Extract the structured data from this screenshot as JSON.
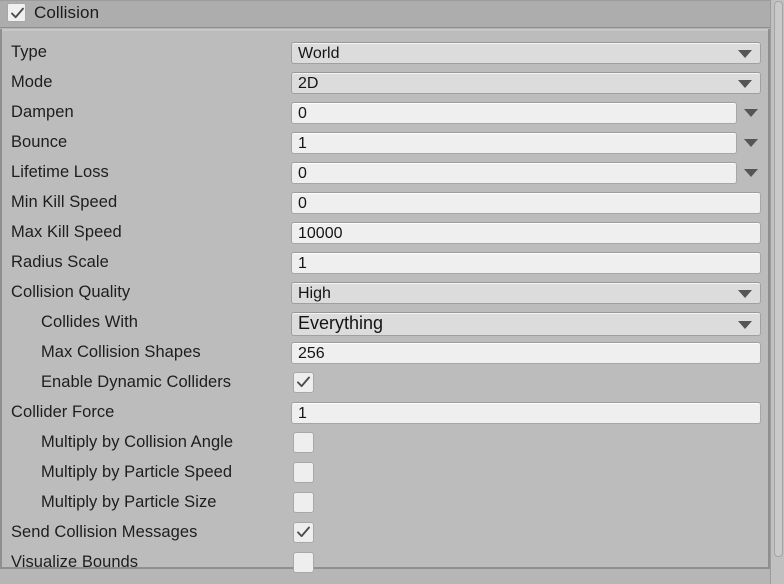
{
  "module": {
    "title": "Collision",
    "enabled": true,
    "checkbox_icon": "check-icon"
  },
  "colors": {
    "panel_bg": "#bcbcbc",
    "header_bg": "#adadad",
    "text_field_bg": "#efefef",
    "popup_field_bg": "#dcdcdc",
    "label_text": "#1e1e1e",
    "caret": "#555555"
  },
  "rows": [
    {
      "label": "Type",
      "indent": 0,
      "control": "popup",
      "value": "World",
      "caret": "chevron-down-icon"
    },
    {
      "label": "Mode",
      "indent": 0,
      "control": "popup",
      "value": "2D",
      "caret": "chevron-down-icon"
    },
    {
      "label": "Dampen",
      "indent": 0,
      "control": "curve",
      "value": "0",
      "caret": "chevron-down-icon"
    },
    {
      "label": "Bounce",
      "indent": 0,
      "control": "curve",
      "value": "1",
      "caret": "chevron-down-icon"
    },
    {
      "label": "Lifetime Loss",
      "indent": 0,
      "control": "curve",
      "value": "0",
      "caret": "chevron-down-icon"
    },
    {
      "label": "Min Kill Speed",
      "indent": 0,
      "control": "text",
      "value": "0",
      "caret": ""
    },
    {
      "label": "Max Kill Speed",
      "indent": 0,
      "control": "text",
      "value": "10000",
      "caret": ""
    },
    {
      "label": "Radius Scale",
      "indent": 0,
      "control": "text",
      "value": "1",
      "caret": ""
    },
    {
      "label": "Collision Quality",
      "indent": 0,
      "control": "popup",
      "value": "High",
      "caret": "chevron-down-icon"
    },
    {
      "label": "Collides With",
      "indent": 1,
      "control": "popupbig",
      "value": "Everything",
      "caret": "chevron-down-icon"
    },
    {
      "label": "Max Collision Shapes",
      "indent": 1,
      "control": "text",
      "value": "256",
      "caret": ""
    },
    {
      "label": "Enable Dynamic Colliders",
      "indent": 1,
      "control": "checkbox",
      "value": true,
      "caret": ""
    },
    {
      "label": "Collider Force",
      "indent": 0,
      "control": "text",
      "value": "1",
      "caret": ""
    },
    {
      "label": "Multiply by Collision Angle",
      "indent": 1,
      "control": "checkbox",
      "value": false,
      "caret": ""
    },
    {
      "label": "Multiply by Particle Speed",
      "indent": 1,
      "control": "checkbox",
      "value": false,
      "caret": ""
    },
    {
      "label": "Multiply by Particle Size",
      "indent": 1,
      "control": "checkbox",
      "value": false,
      "caret": ""
    },
    {
      "label": "Send Collision Messages",
      "indent": 0,
      "control": "checkbox",
      "value": true,
      "caret": ""
    },
    {
      "label": "Visualize Bounds",
      "indent": 0,
      "control": "checkbox",
      "value": false,
      "caret": ""
    }
  ],
  "scrollbar": {
    "name": "vertical-scrollbar",
    "orientation": "vertical"
  }
}
